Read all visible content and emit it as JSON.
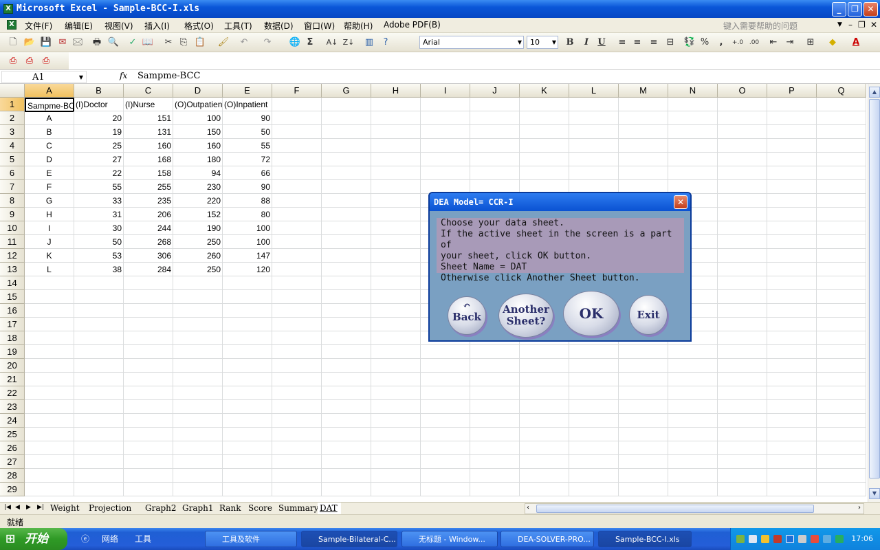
{
  "window": {
    "title": "Microsoft Excel - Sample-BCC-I.xls",
    "app_icon": "excel-icon"
  },
  "menu": {
    "items": [
      "文件(F)",
      "编辑(E)",
      "视图(V)",
      "插入(I)",
      "格式(O)",
      "工具(T)",
      "数据(D)",
      "窗口(W)",
      "帮助(H)",
      "Adobe PDF(B)"
    ],
    "help_placeholder": "键入需要帮助的问题"
  },
  "toolbar": {
    "font": "Arial",
    "size": "10",
    "bold": "B",
    "italic": "I",
    "underline": "U",
    "percent": "%",
    "comma": ","
  },
  "formula": {
    "name_box": "A1",
    "fx": "fx",
    "value": "Sampme-BCC"
  },
  "sheet": {
    "columns": [
      "A",
      "B",
      "C",
      "D",
      "E",
      "F",
      "G",
      "H",
      "I",
      "J",
      "K",
      "L",
      "M",
      "N",
      "O",
      "P",
      "Q"
    ],
    "rows": [
      [
        "Sampme-BCC",
        "(I)Doctor",
        "(I)Nurse",
        "(O)Outpatient",
        "(O)Inpatient"
      ],
      [
        "A",
        "20",
        "151",
        "100",
        "90"
      ],
      [
        "B",
        "19",
        "131",
        "150",
        "50"
      ],
      [
        "C",
        "25",
        "160",
        "160",
        "55"
      ],
      [
        "D",
        "27",
        "168",
        "180",
        "72"
      ],
      [
        "E",
        "22",
        "158",
        "94",
        "66"
      ],
      [
        "F",
        "55",
        "255",
        "230",
        "90"
      ],
      [
        "G",
        "33",
        "235",
        "220",
        "88"
      ],
      [
        "H",
        "31",
        "206",
        "152",
        "80"
      ],
      [
        "I",
        "30",
        "244",
        "190",
        "100"
      ],
      [
        "J",
        "50",
        "268",
        "250",
        "100"
      ],
      [
        "K",
        "53",
        "306",
        "260",
        "147"
      ],
      [
        "L",
        "38",
        "284",
        "250",
        "120"
      ]
    ],
    "row_count": 29,
    "tabs": [
      "Weight",
      "Projection",
      "Graph2",
      "Graph1",
      "Rank",
      "Score",
      "Summary",
      "DAT"
    ],
    "active_tab": "DAT"
  },
  "status": {
    "text": "就绪"
  },
  "dialog": {
    "title": "DEA  Model= CCR-I",
    "lines": [
      "Choose your data sheet.",
      "If the active sheet in the screen is a part of",
      "your sheet, click OK button.",
      "Sheet Name = DAT",
      "Otherwise click Another Sheet button."
    ],
    "buttons": {
      "back": "Back",
      "another": "Another Sheet?",
      "ok": "OK",
      "exit": "Exit"
    }
  },
  "taskbar": {
    "start": "开始",
    "quick": [
      "网络",
      "工具"
    ],
    "tasks": [
      "工具及软件",
      "Sample-Bilateral-C...",
      "无标题 - Window...",
      "DEA-SOLVER-PRO...",
      "Sample-BCC-I.xls"
    ],
    "clock": "17:06"
  }
}
